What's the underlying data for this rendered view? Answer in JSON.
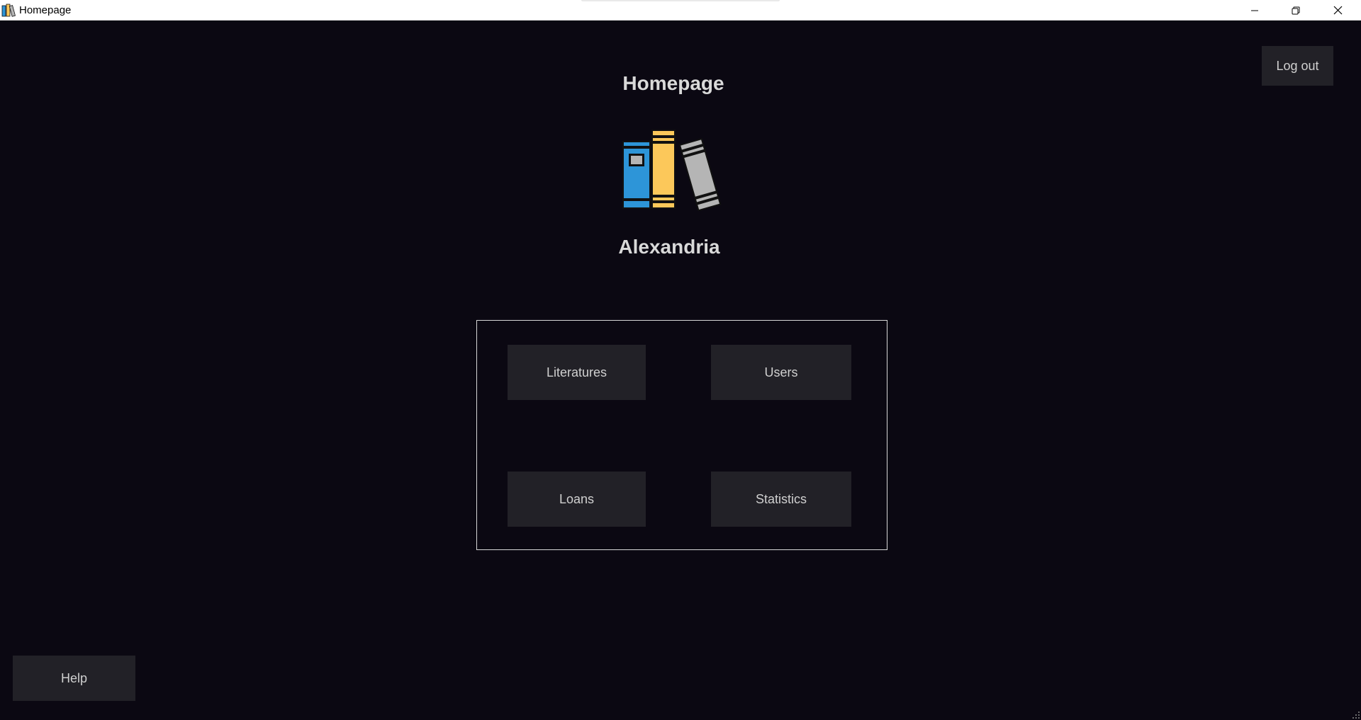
{
  "window": {
    "title": "Homepage",
    "controls": {
      "minimize": "minimize-icon",
      "maximize": "restore-icon",
      "close": "close-icon"
    }
  },
  "header": {
    "title": "Homepage",
    "logout_label": "Log out"
  },
  "brand": {
    "logo_icon": "books-icon",
    "name": "Alexandria",
    "colors": {
      "book_blue": "#2d95d8",
      "book_yellow": "#fcc85a",
      "book_gray": "#b5b5b5"
    }
  },
  "menu": {
    "items": [
      {
        "label": "Literatures"
      },
      {
        "label": "Users"
      },
      {
        "label": "Loans"
      },
      {
        "label": "Statistics"
      }
    ]
  },
  "footer": {
    "help_label": "Help"
  },
  "theme": {
    "background": "#0b0812",
    "button_bg": "#222127",
    "text": "#d0d0d0"
  }
}
